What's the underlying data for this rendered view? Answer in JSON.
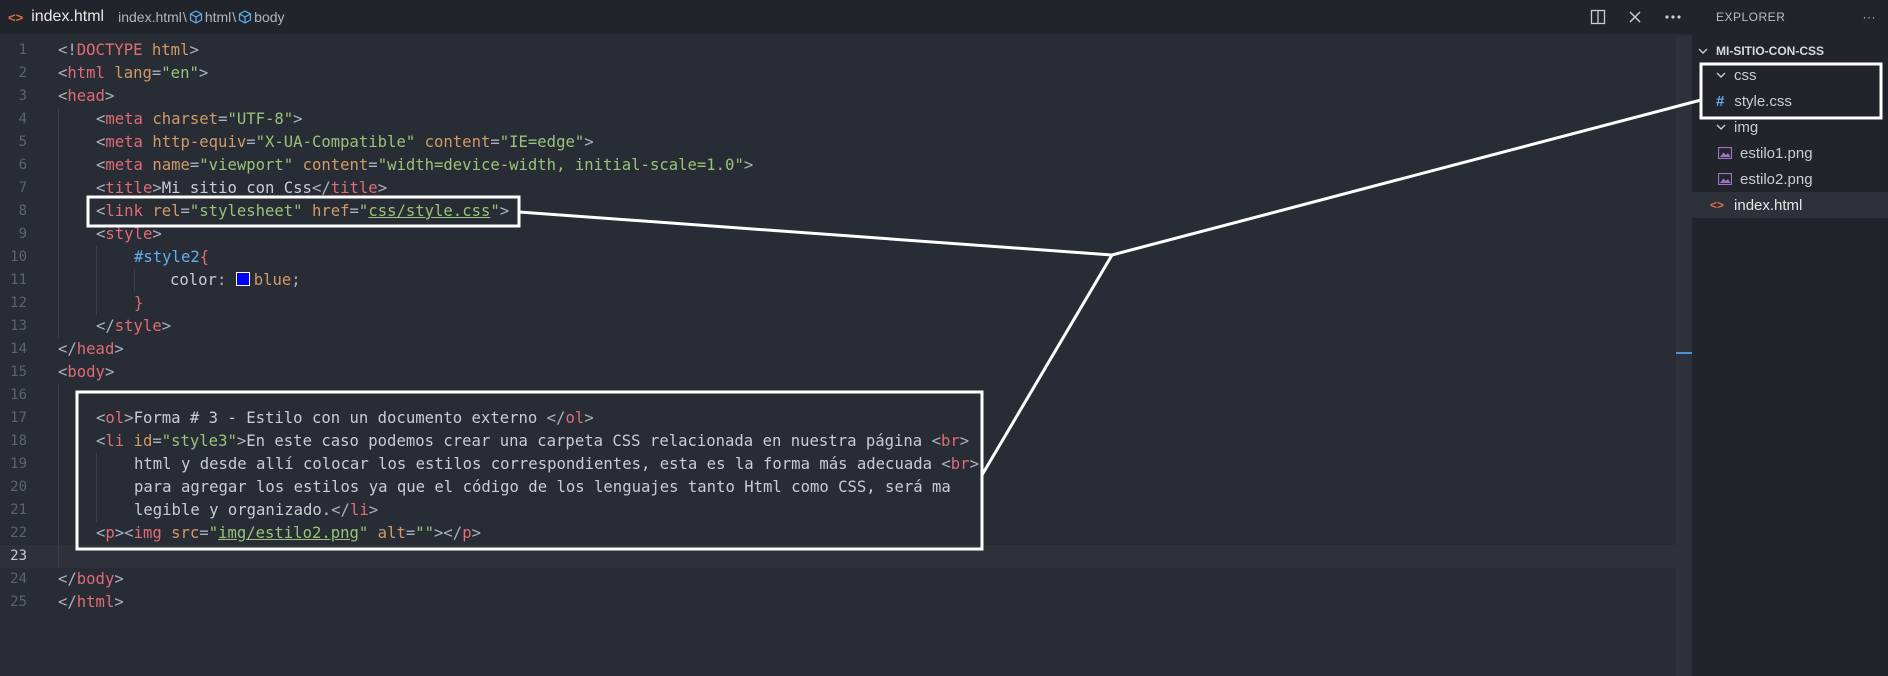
{
  "tab": {
    "icon": "html-file-icon",
    "filename": "index.html"
  },
  "breadcrumb": {
    "file": "index.html",
    "sep1": "\\",
    "sep2": "\\",
    "node1": "html",
    "node2": "body"
  },
  "title_actions": [
    "split-editor-icon",
    "close-icon",
    "more-icon"
  ],
  "editor": {
    "active_line": 23,
    "lines": [
      {
        "n": "1"
      },
      {
        "n": "2"
      },
      {
        "n": "3"
      },
      {
        "n": "4"
      },
      {
        "n": "5"
      },
      {
        "n": "6"
      },
      {
        "n": "7"
      },
      {
        "n": "8"
      },
      {
        "n": "9"
      },
      {
        "n": "10"
      },
      {
        "n": "11"
      },
      {
        "n": "12"
      },
      {
        "n": "13"
      },
      {
        "n": "14"
      },
      {
        "n": "15"
      },
      {
        "n": "16"
      },
      {
        "n": "17"
      },
      {
        "n": "18"
      },
      {
        "n": "19"
      },
      {
        "n": "20"
      },
      {
        "n": "21"
      },
      {
        "n": "22"
      },
      {
        "n": "23"
      },
      {
        "n": "24"
      },
      {
        "n": "25"
      }
    ],
    "code": {
      "l1a": "<!",
      "l1b": "DOCTYPE",
      "l1c": " html",
      "l1d": ">",
      "l2a": "<",
      "l2b": "html",
      "l2c": " lang",
      "l2d": "=",
      "l2e": "\"en\"",
      "l2f": ">",
      "l3a": "<",
      "l3b": "head",
      "l3c": ">",
      "l4a": "<",
      "l4b": "meta",
      "l4c": " charset",
      "l4d": "=",
      "l4e": "\"UTF-8\"",
      "l4f": ">",
      "l5a": "<",
      "l5b": "meta",
      "l5c": " http-equiv",
      "l5d": "=",
      "l5e": "\"X-UA-Compatible\"",
      "l5f": " content",
      "l5g": "=",
      "l5h": "\"IE=edge\"",
      "l5i": ">",
      "l6a": "<",
      "l6b": "meta",
      "l6c": " name",
      "l6d": "=",
      "l6e": "\"viewport\"",
      "l6f": " content",
      "l6g": "=",
      "l6h": "\"width=device-width, initial-scale=1.0\"",
      "l6i": ">",
      "l7a": "<",
      "l7b": "title",
      "l7c": ">",
      "l7d": "Mi sitio con Css",
      "l7e": "</",
      "l7f": "title",
      "l7g": ">",
      "l8a": "<",
      "l8b": "link",
      "l8c": " rel",
      "l8d": "=",
      "l8e": "\"stylesheet\"",
      "l8f": " href",
      "l8g": "=",
      "l8h": "\"",
      "l8i": "css/style.css",
      "l8j": "\"",
      "l8k": ">",
      "l9a": "<",
      "l9b": "style",
      "l9c": ">",
      "l10a": "#style2",
      "l10b": "{",
      "l11a": "color",
      "l11b": ": ",
      "l11c": "blue",
      "l11d": ";",
      "l12a": "}",
      "l13a": "</",
      "l13b": "style",
      "l13c": ">",
      "l14a": "</",
      "l14b": "head",
      "l14c": ">",
      "l15a": "<",
      "l15b": "body",
      "l15c": ">",
      "l17a": "<",
      "l17b": "ol",
      "l17c": ">",
      "l17d": "Forma # 3 - Estilo con un documento externo ",
      "l17e": "</",
      "l17f": "ol",
      "l17g": ">",
      "l18a": "<",
      "l18b": "li",
      "l18c": " id",
      "l18d": "=",
      "l18e": "\"style3\"",
      "l18f": ">",
      "l18g": "En este caso podemos crear una carpeta CSS relacionada en nuestra página ",
      "l18h": "<",
      "l18i": "br",
      "l18j": ">",
      "l19a": "html y desde allí colocar los estilos correspondientes, esta es la forma más adecuada ",
      "l19b": "<",
      "l19c": "br",
      "l19d": ">",
      "l20a": "para agregar los estilos ya que el código de los lenguajes tanto Html como CSS, será ma",
      "l21a": "legible y organizado.",
      "l21b": "</",
      "l21c": "li",
      "l21d": ">",
      "l22a": "<",
      "l22b": "p",
      "l22c": "><",
      "l22d": "img",
      "l22e": " src",
      "l22f": "=",
      "l22g": "\"",
      "l22h": "img/estilo2.png",
      "l22i": "\"",
      "l22j": " alt",
      "l22k": "=",
      "l22l": "\"\"",
      "l22m": "></",
      "l22n": "p",
      "l22o": ">",
      "l24a": "</",
      "l24b": "body",
      "l24c": ">",
      "l25a": "</",
      "l25b": "html",
      "l25c": ">"
    }
  },
  "explorer": {
    "title": "EXPLORER",
    "more": "···",
    "project": "MI-SITIO-CON-CSS",
    "items": [
      {
        "label": "css",
        "type": "folder"
      },
      {
        "label": "style.css",
        "type": "css"
      },
      {
        "label": "img",
        "type": "folder"
      },
      {
        "label": "estilo1.png",
        "type": "image"
      },
      {
        "label": "estilo2.png",
        "type": "image"
      },
      {
        "label": "index.html",
        "type": "html",
        "active": true
      }
    ]
  },
  "colors": {
    "editor_bg": "#282c34",
    "sidebar_bg": "#21252b",
    "tag": "#e06c75",
    "attribute": "#d19a66",
    "string": "#98c379",
    "annotation": "#ffffff"
  }
}
